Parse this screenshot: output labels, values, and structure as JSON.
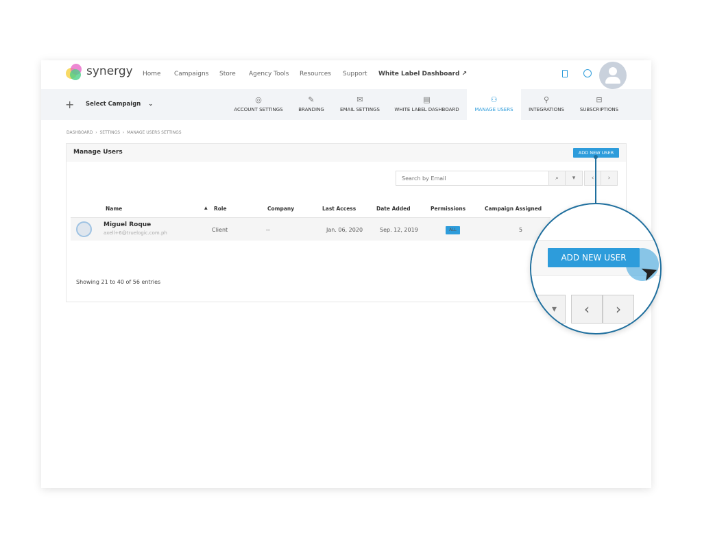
{
  "brand": {
    "name": "synergy"
  },
  "topnav": {
    "items": [
      "Home",
      "Campaigns",
      "Store",
      "Agency Tools",
      "Resources",
      "Support"
    ],
    "white_label": "White Label Dashboard"
  },
  "subnav": {
    "select_campaign": "Select Campaign",
    "tabs": [
      {
        "label": "ACCOUNT SETTINGS",
        "icon": "user-circle-icon"
      },
      {
        "label": "BRANDING",
        "icon": "pencil-icon"
      },
      {
        "label": "EMAIL SETTINGS",
        "icon": "envelope-icon"
      },
      {
        "label": "WHITE LABEL DASHBOARD",
        "icon": "document-star-icon"
      },
      {
        "label": "MANAGE USERS",
        "icon": "users-icon",
        "active": true
      },
      {
        "label": "INTEGRATIONS",
        "icon": "plug-icon"
      },
      {
        "label": "SUBSCRIPTIONS",
        "icon": "receipt-icon"
      }
    ]
  },
  "breadcrumb": [
    "DASHBOARD",
    "SETTINGS",
    "MANAGE USERS SETTINGS"
  ],
  "panel": {
    "title": "Manage Users",
    "add_button": "ADD NEW USER",
    "search_placeholder": "Search by Email",
    "columns": [
      "Name",
      "Role",
      "Company",
      "Last Access",
      "Date Added",
      "Permissions",
      "Campaign Assigned"
    ],
    "rows": [
      {
        "name": "Miguel Roque",
        "email": "axell+6@truelogic.com.ph",
        "role": "Client",
        "company": "--",
        "last_access": "Jan. 06, 2020",
        "date_added": "Sep. 12, 2019",
        "permissions": "ALL",
        "campaigns": "5"
      }
    ],
    "footer": "Showing 21 to 40 of 56 entries"
  },
  "colors": {
    "accent": "#2d9cdb",
    "magnifier_border": "#1f6f9e"
  }
}
